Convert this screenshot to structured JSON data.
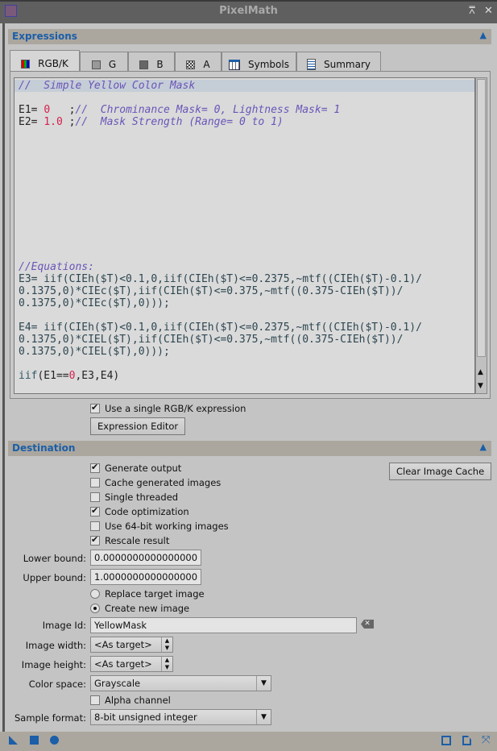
{
  "window": {
    "title": "PixelMath"
  },
  "expressions": {
    "header": "Expressions",
    "tabs": [
      {
        "label": "RGB/K"
      },
      {
        "label": "G"
      },
      {
        "label": "B"
      },
      {
        "label": "A"
      },
      {
        "label": "Symbols"
      },
      {
        "label": "Summary"
      }
    ],
    "code_lines": [
      "//  Simple Yellow Color Mask",
      "",
      "E1= 0   ;//  Chrominance Mask= 0, Lightness Mask= 1",
      "E2= 1.0 ;//  Mask Strength (Range= 0 to 1)",
      "",
      "",
      "",
      "",
      "",
      "",
      "",
      "",
      "",
      "",
      "",
      "//Equations:",
      "E3= iif(CIEh($T)<0.1,0,iif(CIEh($T)<=0.2375,~mtf((CIEh($T)-0.1)/",
      "0.1375,0)*CIEc($T),iif(CIEh($T)<=0.375,~mtf((0.375-CIEh($T))/",
      "0.1375,0)*CIEc($T),0)));",
      "",
      "E4= iif(CIEh($T)<0.1,0,iif(CIEh($T)<=0.2375,~mtf((CIEh($T)-0.1)/",
      "0.1375,0)*CIEL($T),iif(CIEh($T)<=0.375,~mtf((0.375-CIEh($T))/",
      "0.1375,0)*CIEL($T),0)));",
      "",
      "iif(E1==0,E3,E4)"
    ],
    "single_rgbk_label": "Use a single RGB/K expression",
    "single_rgbk_checked": true,
    "editor_button": "Expression Editor"
  },
  "destination": {
    "header": "Destination",
    "options": [
      {
        "label": "Generate output",
        "checked": true
      },
      {
        "label": "Cache generated images",
        "checked": false
      },
      {
        "label": "Single threaded",
        "checked": false
      },
      {
        "label": "Code optimization",
        "checked": true
      },
      {
        "label": "Use 64-bit working images",
        "checked": false
      },
      {
        "label": "Rescale result",
        "checked": true
      }
    ],
    "clear_cache_button": "Clear Image Cache",
    "lower_bound_label": "Lower bound:",
    "lower_bound": "0.0000000000000000",
    "upper_bound_label": "Upper bound:",
    "upper_bound": "1.0000000000000000",
    "replace_label": "Replace target image",
    "create_label": "Create new image",
    "mode": "create",
    "image_id_label": "Image Id:",
    "image_id": "YellowMask",
    "image_width_label": "Image width:",
    "image_width": "<As target>",
    "image_height_label": "Image height:",
    "image_height": "<As target>",
    "color_space_label": "Color space:",
    "color_space": "Grayscale",
    "alpha_label": "Alpha channel",
    "alpha_checked": false,
    "sample_format_label": "Sample format:",
    "sample_format": "8-bit unsigned integer"
  }
}
